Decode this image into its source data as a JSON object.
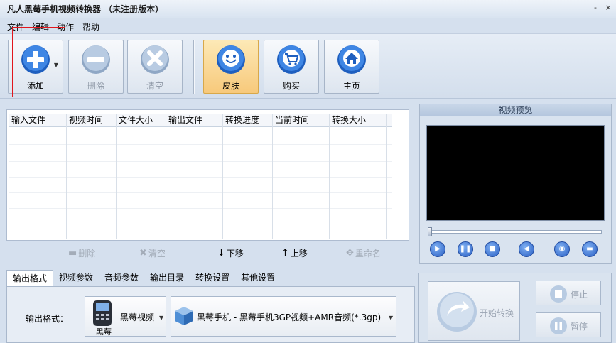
{
  "window": {
    "title": "凡人黑莓手机视频转换器 （未注册版本）",
    "min": "-",
    "close": "×"
  },
  "menu": [
    "文件",
    "编辑",
    "动作",
    "帮助"
  ],
  "toolbar": {
    "add": "添加",
    "delete": "删除",
    "clear": "清空",
    "skin": "皮肤",
    "buy": "购买",
    "home": "主页"
  },
  "table": {
    "columns": [
      "输入文件",
      "视频时间",
      "文件大小",
      "输出文件",
      "转换进度",
      "当前时间",
      "转换大小"
    ]
  },
  "list_controls": {
    "delete": "删除",
    "clear": "清空",
    "down": "下移",
    "up": "上移",
    "rename": "重命名"
  },
  "preview": {
    "title": "视频预览"
  },
  "tabs": [
    "输出格式",
    "视频参数",
    "音频参数",
    "输出目录",
    "转换设置",
    "其他设置"
  ],
  "output": {
    "label": "输出格式：",
    "device": "黑莓视频",
    "device_caption": "黑莓",
    "format": "黑莓手机 - 黑莓手机3GP视频+AMR音频(*.3gp)"
  },
  "actions": {
    "start": "开始转换",
    "stop": "停止",
    "pause": "暂停"
  },
  "colors": {
    "accent_blue": "#2a6fd0",
    "skin_active": "#f7c97b",
    "highlight_red": "#e1161d"
  }
}
